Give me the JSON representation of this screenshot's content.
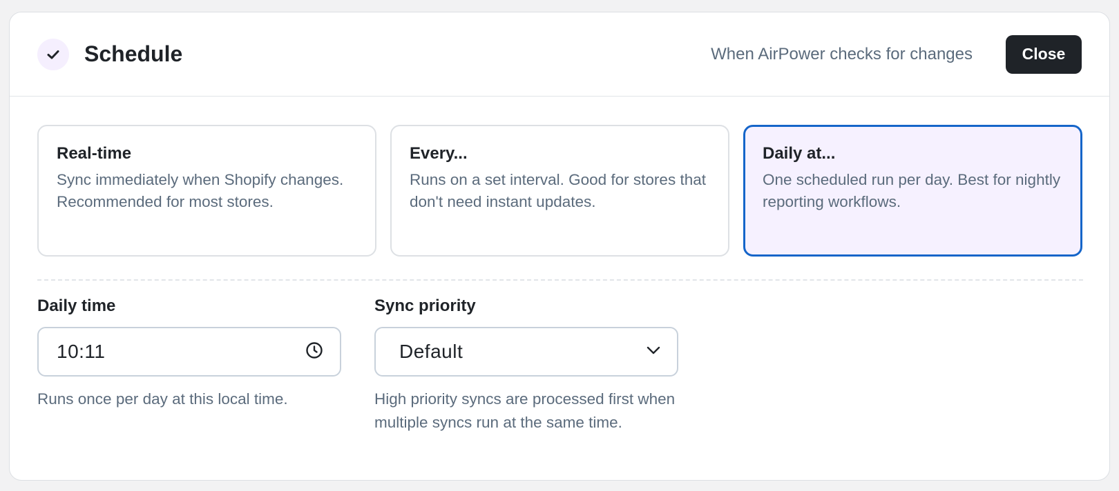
{
  "header": {
    "title": "Schedule",
    "subtitle": "When AirPower checks for changes",
    "close_label": "Close"
  },
  "options": [
    {
      "title": "Real-time",
      "description": "Sync immediately when Shopify changes. Recommended for most stores.",
      "selected": false
    },
    {
      "title": "Every...",
      "description": "Runs on a set interval. Good for stores that don't need instant updates.",
      "selected": false
    },
    {
      "title": "Daily at...",
      "description": "One scheduled run per day. Best for nightly reporting workflows.",
      "selected": true
    }
  ],
  "daily_time": {
    "label": "Daily time",
    "value": "10:11",
    "help": "Runs once per day at this local time."
  },
  "sync_priority": {
    "label": "Sync priority",
    "value": "Default",
    "help": "High priority syncs are processed first when multiple syncs run at the same time."
  },
  "colors": {
    "selected_border": "#1565c9",
    "selected_background": "#f6f1ff",
    "primary_button": "#1f2328",
    "muted_text": "#5b6b7c"
  },
  "icons": {
    "badge": "check-icon",
    "time_field": "clock-icon",
    "select_field": "chevron-down-icon"
  }
}
